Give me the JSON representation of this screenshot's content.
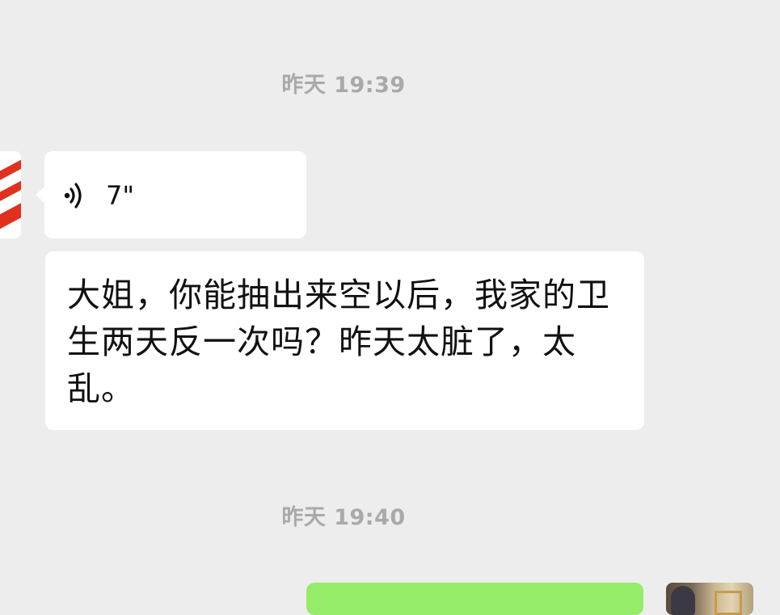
{
  "chat": {
    "messages": [
      {
        "timestamp": "昨天 19:39",
        "sender": "other",
        "type": "voice",
        "duration": "7\""
      },
      {
        "sender": "other",
        "type": "text",
        "text": "大姐，你能抽出来空以后，我家的卫生两天反一次吗？昨天太脏了，太乱。"
      },
      {
        "timestamp": "昨天 19:40",
        "sender": "self",
        "type": "text",
        "text": ""
      }
    ]
  },
  "icons": {
    "voice": "voice-wave-icon"
  },
  "colors": {
    "background": "#ededed",
    "incoming_bubble": "#ffffff",
    "outgoing_bubble": "#95ec69",
    "timestamp_text": "#a9a9a9",
    "avatar_accent": "#e0311f"
  }
}
